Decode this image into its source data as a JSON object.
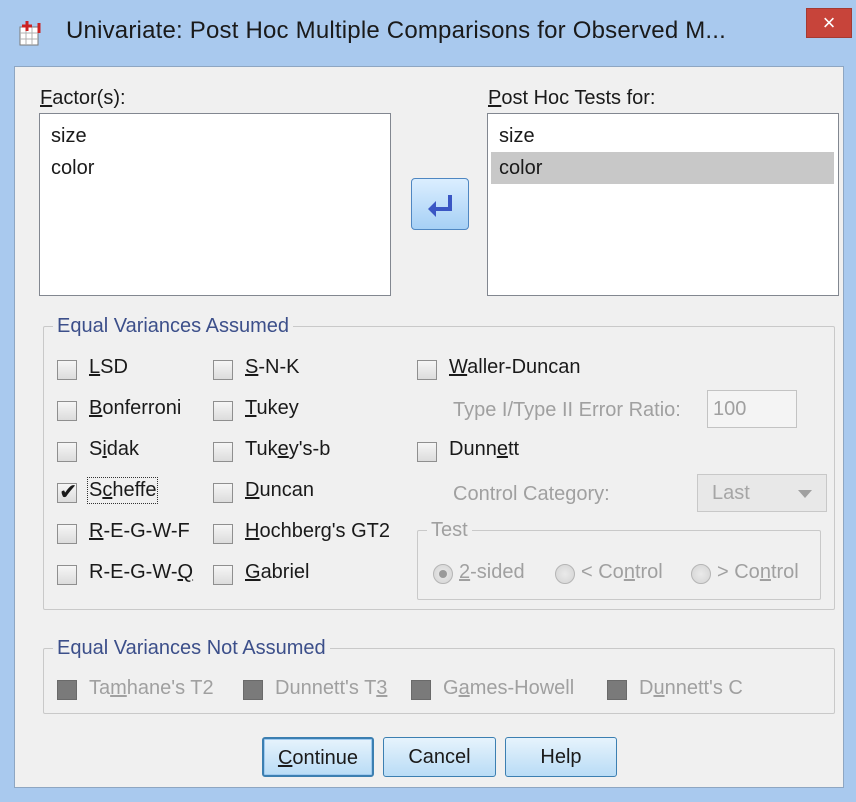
{
  "window": {
    "title": "Univariate: Post Hoc Multiple Comparisons for Observed M...",
    "close_glyph": "×"
  },
  "factors": {
    "label_underlined": "F",
    "label_rest": "actor(s):",
    "items": [
      "size",
      "color"
    ]
  },
  "posthoc": {
    "label_underlined": "P",
    "label_rest": "ost Hoc Tests for:",
    "items": [
      "size",
      "color"
    ],
    "selected_index": 1
  },
  "equal_assumed": {
    "title": "Equal Variances Assumed",
    "lsd": {
      "u": "L",
      "rest": "SD",
      "checked": false
    },
    "bonferroni": {
      "u": "B",
      "rest": "onferroni",
      "checked": false
    },
    "sidak": {
      "pre": "S",
      "u": "i",
      "rest": "dak",
      "checked": false
    },
    "scheffe": {
      "pre": "S",
      "u": "c",
      "rest": "heffe",
      "checked": true
    },
    "regwf": {
      "u": "R",
      "rest": "-E-G-W-F",
      "checked": false
    },
    "regwq": {
      "pre": "R-E-G-W-",
      "u": "Q",
      "checked": false
    },
    "snk": {
      "u": "S",
      "rest": "-N-K",
      "checked": false
    },
    "tukey": {
      "u": "T",
      "rest": "ukey",
      "checked": false
    },
    "tukeyb": {
      "pre": "Tuk",
      "u": "e",
      "rest": "y's-b",
      "checked": false
    },
    "duncan": {
      "u": "D",
      "rest": "uncan",
      "checked": false
    },
    "hochberg": {
      "u": "H",
      "rest": "ochberg's GT2",
      "checked": false
    },
    "gabriel": {
      "u": "G",
      "rest": "abriel",
      "checked": false
    },
    "waller": {
      "u": "W",
      "rest": "aller-Duncan",
      "checked": false
    },
    "error_ratio_label": "Type I/Type II Error Ratio:",
    "error_ratio_value": "100",
    "dunnett": {
      "pre": "Dunn",
      "u": "e",
      "rest": "tt",
      "checked": false
    },
    "control_category_label": "Control Category:",
    "control_category_value": "Last",
    "test_group_title": "Test",
    "radio_2sided": {
      "u": "2",
      "rest": "-sided",
      "selected": true
    },
    "radio_lt": {
      "pre": "< Co",
      "u": "n",
      "rest": "trol",
      "selected": false
    },
    "radio_gt": {
      "pre": "> Co",
      "u": "n",
      "rest": "trol",
      "selected": false
    }
  },
  "equal_not_assumed": {
    "title": "Equal Variances Not Assumed",
    "tamhane": {
      "pre": "Ta",
      "u": "m",
      "rest": "hane's T2"
    },
    "dunnett_t3": {
      "pre": "Dunnett's T",
      "u": "3"
    },
    "games_howell": {
      "pre": "G",
      "u": "a",
      "rest": "mes-Howell"
    },
    "dunnett_c": {
      "pre": "D",
      "u": "u",
      "rest": "nnett's C"
    }
  },
  "buttons": {
    "continue": {
      "u": "C",
      "rest": "ontinue"
    },
    "cancel": "Cancel",
    "help": "Help"
  },
  "colors": {
    "titlebar": "#a9c9ee",
    "close": "#c7443a",
    "group_title": "#3c4f8a",
    "button_border": "#3c7fb1"
  }
}
